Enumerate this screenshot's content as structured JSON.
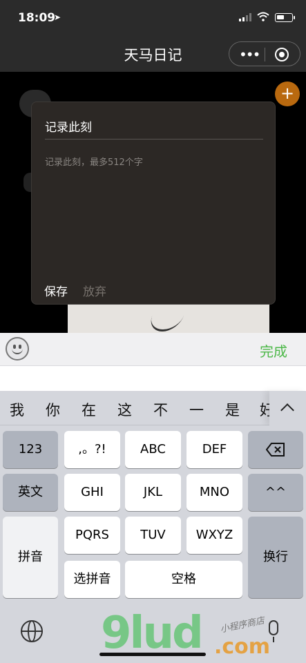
{
  "status_bar": {
    "time": "18:09",
    "location_icon": "location-arrow-icon",
    "signal_icon": "cellular-signal-icon",
    "wifi_icon": "wifi-icon",
    "battery_icon": "battery-icon"
  },
  "nav": {
    "title": "天马日记",
    "more_icon": "more-dots-icon",
    "close_icon": "close-circle-icon"
  },
  "background": {
    "add_icon": "plus-icon",
    "accent_color": "#b9690f"
  },
  "modal": {
    "title": "记录此刻",
    "placeholder": "记录此刻，最多512个字",
    "save_label": "保存",
    "discard_label": "放弃"
  },
  "accessory": {
    "emoji_icon": "emoji-icon",
    "done_label": "完成",
    "done_color": "#4cb848"
  },
  "candidates": [
    "我",
    "你",
    "在",
    "这",
    "不",
    "一",
    "是",
    "好"
  ],
  "keyboard": {
    "row1": [
      "123",
      ",。?!",
      "ABC",
      "DEF"
    ],
    "row2": [
      "英文",
      "GHI",
      "JKL",
      "MNO",
      "^^"
    ],
    "row3": [
      "拼音",
      "PQRS",
      "TUV",
      "WXYZ",
      "换行"
    ],
    "row4": [
      "选拼音",
      "空格"
    ],
    "delete_icon": "backspace-icon",
    "globe_icon": "globe-icon",
    "mic_icon": "microphone-icon"
  },
  "watermark": {
    "main": "9lud",
    "suffix": ".com",
    "script": "小程序商店"
  }
}
